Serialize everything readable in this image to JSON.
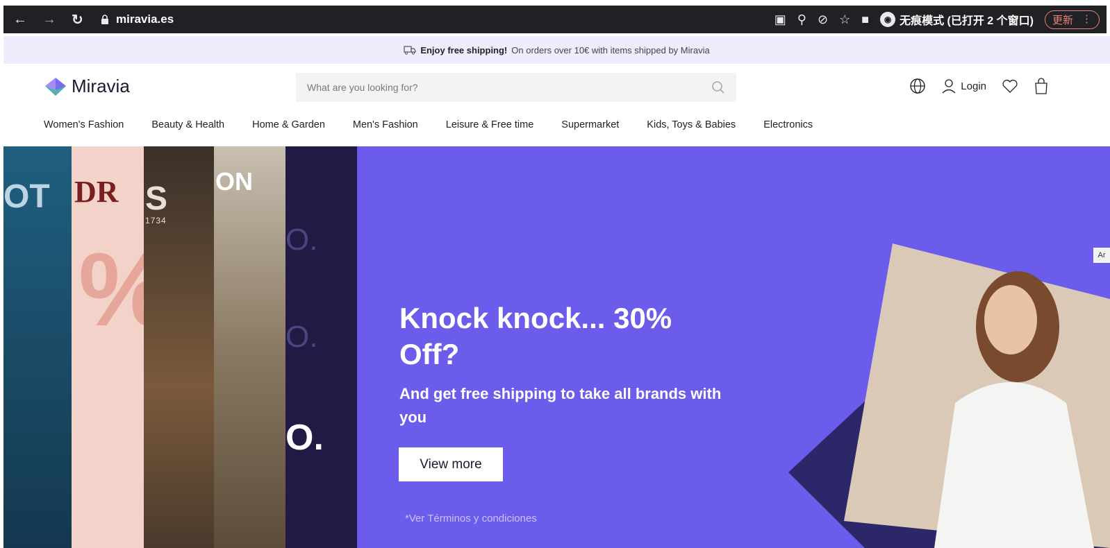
{
  "browser": {
    "url": "miravia.es",
    "incognito_label": "无痕模式 (已打开 2 个窗口)",
    "update_label": "更新"
  },
  "announcement": {
    "bold": "Enjoy free shipping!",
    "text": "On orders over 10€ with items shipped by Miravia"
  },
  "header": {
    "logo": "Miravia",
    "search_placeholder": "What are you looking for?",
    "login": "Login"
  },
  "categories": [
    "Women's Fashion",
    "Beauty & Health",
    "Home & Garden",
    "Men's Fashion",
    "Leisure & Free time",
    "Supermarket",
    "Kids, Toys & Babies",
    "Electronics"
  ],
  "hero": {
    "title": "Knock knock... 30% Off?",
    "subtitle": "And get free shipping to take all brands with you",
    "button": "View more",
    "terms": "*Ver Términos y condiciones",
    "side_tab": "Ar",
    "brand_fragments": [
      "OT",
      "DR",
      "S",
      "1734",
      "ON",
      "O.",
      "O.",
      "O."
    ]
  },
  "colors": {
    "hero_bg": "#6c5ceb",
    "announce_bg": "#eeedfd",
    "chrome_bg": "#202124",
    "navy": "#2c2768"
  }
}
